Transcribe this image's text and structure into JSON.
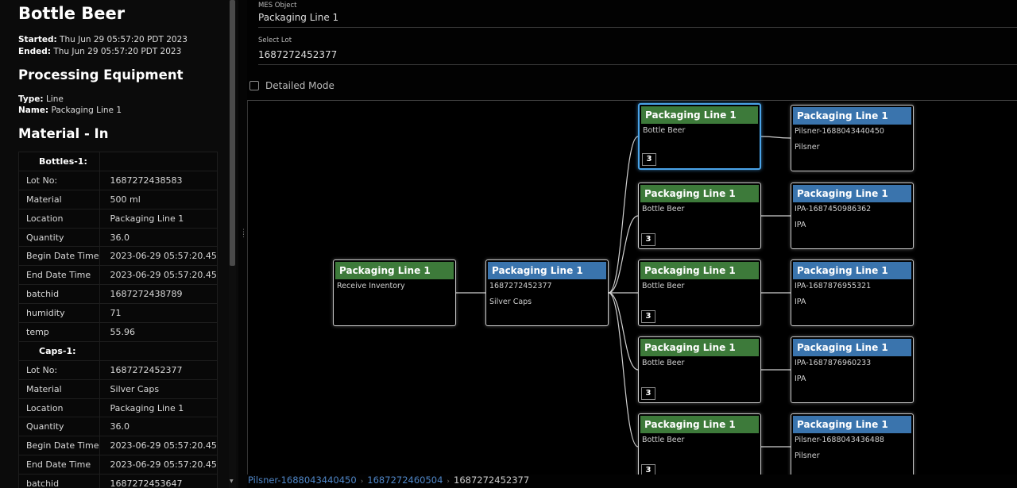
{
  "batch": {
    "title": "Bottle Beer",
    "started_label": "Started:",
    "started": "Thu Jun 29 05:57:20 PDT 2023",
    "ended_label": "Ended:",
    "ended": "Thu Jun 29 05:57:20 PDT 2023"
  },
  "equipment": {
    "heading": "Processing Equipment",
    "type_label": "Type:",
    "type": "Line",
    "name_label": "Name:",
    "name": "Packaging Line 1"
  },
  "material_in": {
    "heading": "Material - In",
    "groups": [
      {
        "name": "Bottles-1:",
        "rows": [
          [
            "Lot No:",
            "1687272438583"
          ],
          [
            "Material",
            "500 ml"
          ],
          [
            "Location",
            "Packaging Line 1"
          ],
          [
            "Quantity",
            "36.0"
          ],
          [
            "Begin Date Time",
            "2023-06-29 05:57:20.45"
          ],
          [
            "End Date Time",
            "2023-06-29 05:57:20.45"
          ],
          [
            "batchid",
            "1687272438789"
          ],
          [
            "humidity",
            "71"
          ],
          [
            "temp",
            "55.96"
          ]
        ]
      },
      {
        "name": "Caps-1:",
        "rows": [
          [
            "Lot No:",
            "1687272452377"
          ],
          [
            "Material",
            "Silver Caps"
          ],
          [
            "Location",
            "Packaging Line 1"
          ],
          [
            "Quantity",
            "36.0"
          ],
          [
            "Begin Date Time",
            "2023-06-29 05:57:20.45"
          ],
          [
            "End Date Time",
            "2023-06-29 05:57:20.45"
          ],
          [
            "batchid",
            "1687272453647"
          ]
        ]
      }
    ]
  },
  "fields": {
    "mes_label": "MES Object",
    "mes_value": "Packaging Line 1",
    "lot_label": "Select Lot",
    "lot_value": "1687272452377",
    "detailed_label": "Detailed Mode"
  },
  "graph": {
    "nodes": [
      {
        "id": "n0",
        "title": "Packaging Line 1",
        "color": "green",
        "l1": "Receive Inventory",
        "l2": "",
        "count": ""
      },
      {
        "id": "n1",
        "title": "Packaging Line 1",
        "color": "blue",
        "l1": "1687272452377",
        "l2": "Silver Caps",
        "count": ""
      },
      {
        "id": "g0",
        "title": "Packaging Line 1",
        "color": "green",
        "l1": "Bottle Beer",
        "l2": "",
        "count": "3",
        "selected": true
      },
      {
        "id": "g1",
        "title": "Packaging Line 1",
        "color": "green",
        "l1": "Bottle Beer",
        "l2": "",
        "count": "3"
      },
      {
        "id": "g2",
        "title": "Packaging Line 1",
        "color": "green",
        "l1": "Bottle Beer",
        "l2": "",
        "count": "3"
      },
      {
        "id": "g3",
        "title": "Packaging Line 1",
        "color": "green",
        "l1": "Bottle Beer",
        "l2": "",
        "count": "3"
      },
      {
        "id": "g4",
        "title": "Packaging Line 1",
        "color": "green",
        "l1": "Bottle Beer",
        "l2": "",
        "count": "3"
      },
      {
        "id": "b0",
        "title": "Packaging Line 1",
        "color": "blue",
        "l1": "Pilsner-1688043440450",
        "l2": "Pilsner",
        "count": ""
      },
      {
        "id": "b1",
        "title": "Packaging Line 1",
        "color": "blue",
        "l1": "IPA-1687450986362",
        "l2": "IPA",
        "count": ""
      },
      {
        "id": "b2",
        "title": "Packaging Line 1",
        "color": "blue",
        "l1": "IPA-1687876955321",
        "l2": "IPA",
        "count": ""
      },
      {
        "id": "b3",
        "title": "Packaging Line 1",
        "color": "blue",
        "l1": "IPA-1687876960233",
        "l2": "IPA",
        "count": ""
      },
      {
        "id": "b4",
        "title": "Packaging Line 1",
        "color": "blue",
        "l1": "Pilsner-1688043436488",
        "l2": "Pilsner",
        "count": ""
      }
    ],
    "edges": [
      [
        "n0",
        "n1"
      ],
      [
        "n1",
        "g0"
      ],
      [
        "n1",
        "g1"
      ],
      [
        "n1",
        "g2"
      ],
      [
        "n1",
        "g3"
      ],
      [
        "n1",
        "g4"
      ],
      [
        "g0",
        "b0"
      ],
      [
        "g1",
        "b1"
      ],
      [
        "g2",
        "b2"
      ],
      [
        "g3",
        "b3"
      ],
      [
        "g4",
        "b4"
      ]
    ]
  },
  "breadcrumb": {
    "items": [
      "Pilsner-1688043440450",
      "1687272460504"
    ],
    "current": "1687272452377"
  },
  "colors": {
    "green": "#3d7a3a",
    "blue": "#3a74ad",
    "selected": "#4aa3e8",
    "link": "#4f86c7"
  }
}
